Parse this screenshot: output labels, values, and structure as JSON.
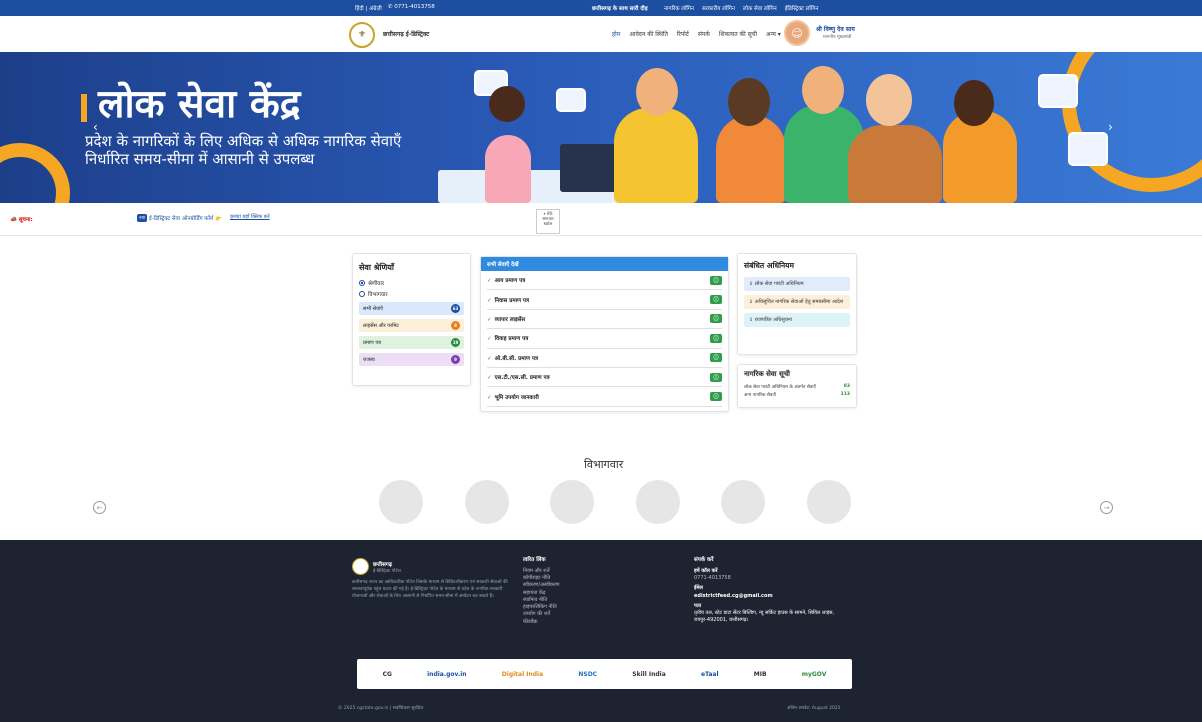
{
  "topbar": {
    "lang": "हिंदी | अंग्रेज़ी",
    "phone": "0771-4013758",
    "tagline": "छत्तीसगढ़ के साथ सारी दौड़",
    "links": [
      "नागरिक लॉगिन",
      "सरकारीय लॉगिन",
      "लोक सेवा लॉगिन",
      "ईडिस्ट्रिक्ट लॉगिन"
    ]
  },
  "header": {
    "brand": "छत्तीसगढ़ ई-डिस्ट्रिक्ट",
    "nav": [
      "होम",
      "आवेदन की स्थिति",
      "रिपोर्ट",
      "संपर्क",
      "शिकायत की सूची",
      "अन्य ▾"
    ],
    "cm_name": "श्री विष्णु देव साय",
    "cm_role": "माननीय मुख्यमंत्री"
  },
  "banner": {
    "title": "लोक सेवा केंद्र",
    "subtitle": "प्रदेश के नागरिकों के लिए अधिक से अधिक नागरिक सेवाएँ निर्धारित समय-सीमा में आसानी से उपलब्ध"
  },
  "notice": {
    "label": "सूचना:",
    "badge": "नया",
    "message": "ई-डिस्ट्रिक्ट सेवा ऑनबोर्डिंग फॉर्म 👉",
    "link": "कृपया यहाँ क्लिक करें",
    "pause": "⏸ रोकें\nसमाचार\nस्क्रोल"
  },
  "categories": {
    "title": "सेवा श्रेणियाँ",
    "radios": [
      "श्रेणीवार",
      "विभागवार"
    ],
    "items": [
      {
        "label": "सभी सेवाएँ",
        "count": "63",
        "bg": "#dbe7fb",
        "dot": "#1c4fa0"
      },
      {
        "label": "लाइसेंस और परमिट",
        "count": "8",
        "bg": "#fcf0d8",
        "dot": "#e67e22"
      },
      {
        "label": "प्रमाण पत्र",
        "count": "19",
        "bg": "#dff2df",
        "dot": "#2e8b3d"
      },
      {
        "label": "राजस्व",
        "count": "9",
        "bg": "#ecdff5",
        "dot": "#7b3fb0"
      }
    ]
  },
  "services": {
    "header": "सभी सेवाएँ देखें",
    "items": [
      "आय प्रमाण पत्र",
      "निवास प्रमाण पत्र",
      "व्यापार लाइसेंस",
      "विवाह प्रमाण पत्र",
      "ओ.बी.सी. प्रमाण पत्र",
      "एस.टी./एस.सी. प्रमाण पत्र",
      "भूमि उपयोग जानकारी"
    ]
  },
  "acts": {
    "title": "संबंधित अधिनियम",
    "items": [
      {
        "label": "⇓ लोक सेवा गारंटी अधिनियम",
        "bg": "#e1ecfb"
      },
      {
        "label": "⇓ अधिसूचित नागरिक सेवाओं हेतु समयसीमा आदेश",
        "bg": "#fcf0d8"
      },
      {
        "label": "⇓ राजपत्रित अधिसूचना",
        "bg": "#dcf3f8"
      }
    ]
  },
  "citizen": {
    "title": "नागरिक सेवा सूची",
    "rows": [
      {
        "label": "लोक सेवा गारंटी अधिनियम के अंतर्गत सेवाएँ",
        "count": "83"
      },
      {
        "label": "अन्य नागरिक सेवाएँ",
        "count": "113"
      }
    ]
  },
  "departments": {
    "title": "विभागवार"
  },
  "footer": {
    "brand": "छत्तीसगढ़",
    "brand_sub": "ई-डिस्ट्रिक्ट पोर्टल",
    "desc": "छत्तीसगढ़ राज्य का आधिकारिक पोर्टल जिसके माध्यम से डिजिटलीकरण एवं सरकारी सेवाओं की सरलतापूर्वक पहुंच प्रदान की गई है। ई-डिस्ट्रिक्ट पोर्टल के माध्यम से प्रदेश के नागरिक सरकारी योजनाओं और सेवाओं के लिए आसानी से निर्धारित समय-सीमा में आवेदन कर सकते हैं।",
    "links_title": "त्वरित लिंक",
    "links": [
      "नियम और शर्तें",
      "कॉपीराइट नीति",
      "स्वीकरण/अस्वीकरण",
      "सहायता केंद्र",
      "स्वामित्व नीति",
      "हाइपरलिंकिंग नीति",
      "उपयोग की शर्तें",
      "फीडबैक"
    ],
    "contact_title": "संपर्क करें",
    "call_label": "हमें कॉल करें",
    "call": "0771-4013758",
    "email_label": "ईमेल",
    "email": "edistrictfeed.cg@gmail.com",
    "addr_label": "पता",
    "addr": "तृतीय तल, स्टेट डाटा सेंटर बिल्डिंग, न्यू सर्किट हाउस के सामने, सिविल लाइंस, रायपुर-492001, छत्तीसगढ़।",
    "partners": [
      "CG",
      "india.gov.in",
      "Digital India",
      "NSDC",
      "Skill India",
      "eTaal",
      "MIB",
      "myGOV"
    ],
    "copyright": "© 2025 cgstate.gov.in | सर्वाधिकार सुरक्षित.",
    "updated": "अंतिम अपडेट: August 2025"
  }
}
